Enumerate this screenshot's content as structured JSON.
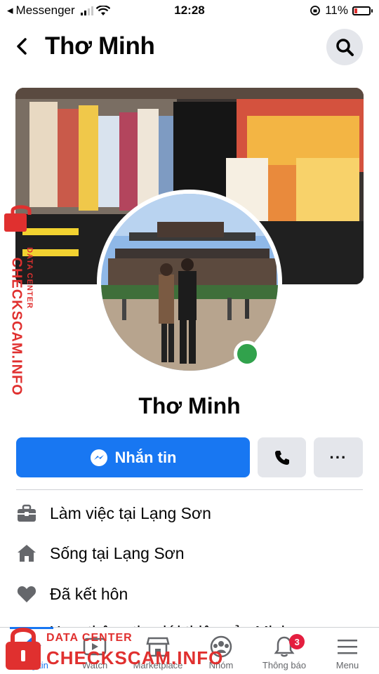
{
  "status_bar": {
    "carrier": "Messenger",
    "time": "12:28",
    "battery": "11%"
  },
  "header": {
    "title": "Thơ Minh"
  },
  "profile": {
    "name": "Thơ Minh",
    "online": true
  },
  "actions": {
    "message_label": "Nhắn tin",
    "more_label": "···"
  },
  "info": [
    {
      "icon": "briefcase-icon",
      "text": "Làm việc tại Lạng Sơn"
    },
    {
      "icon": "home-icon",
      "text": "Sống tại Lạng Sơn"
    },
    {
      "icon": "heart-icon",
      "text": "Đã kết hôn"
    }
  ],
  "info_partial": "Xem thông tin giới thiệu của Minh",
  "nav": [
    {
      "label": "Bảng tin",
      "icon": "home-icon",
      "active": true
    },
    {
      "label": "Watch",
      "icon": "video-icon"
    },
    {
      "label": "Marketplace",
      "icon": "marketplace-icon"
    },
    {
      "label": "Nhóm",
      "icon": "groups-icon"
    },
    {
      "label": "Thông báo",
      "icon": "bell-icon",
      "badge": "3"
    },
    {
      "label": "Menu",
      "icon": "menu-icon"
    }
  ],
  "watermark": {
    "side_sub": "DATA CENTER",
    "side_main": "CHECKSCAM.INFO",
    "bottom_sub": "DATA CENTER",
    "bottom_main": "CHECKSCAM.INFO"
  },
  "colors": {
    "accent": "#1877f2",
    "online": "#31a24c",
    "badge": "#e41e3f",
    "watermark": "#e0302f"
  }
}
